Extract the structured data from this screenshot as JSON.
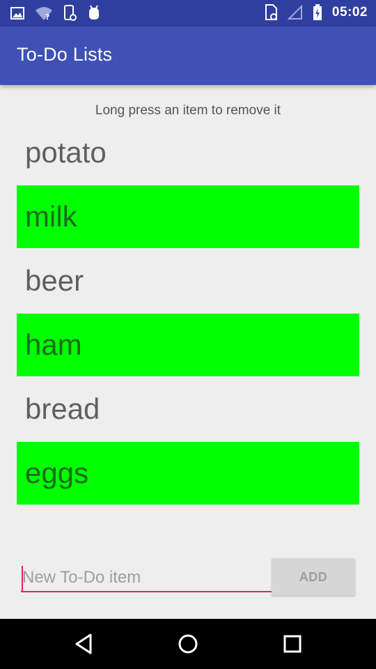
{
  "status_bar": {
    "time": "05:02",
    "icons_left": [
      "image-icon",
      "wifi-question-icon",
      "phone-settings-icon",
      "android-debug-icon"
    ],
    "icons_right": [
      "sim-card-icon",
      "signal-icon",
      "battery-charging-icon"
    ]
  },
  "app_bar": {
    "title": "To-Do Lists"
  },
  "main": {
    "hint": "Long press an item to remove it",
    "items": [
      {
        "label": "potato",
        "highlighted": false
      },
      {
        "label": "milk",
        "highlighted": true
      },
      {
        "label": "beer",
        "highlighted": false
      },
      {
        "label": "ham",
        "highlighted": true
      },
      {
        "label": "bread",
        "highlighted": false
      },
      {
        "label": "eggs",
        "highlighted": true
      }
    ],
    "highlight_color": "#00ff00"
  },
  "input": {
    "placeholder": "New To-Do item",
    "value": "",
    "add_label": "ADD"
  },
  "nav_bar": {
    "back": "back-icon",
    "home": "home-icon",
    "recents": "recents-icon"
  },
  "colors": {
    "primary": "#3f51b5",
    "primary_dark": "#303f9f",
    "accent": "#e91e63"
  }
}
